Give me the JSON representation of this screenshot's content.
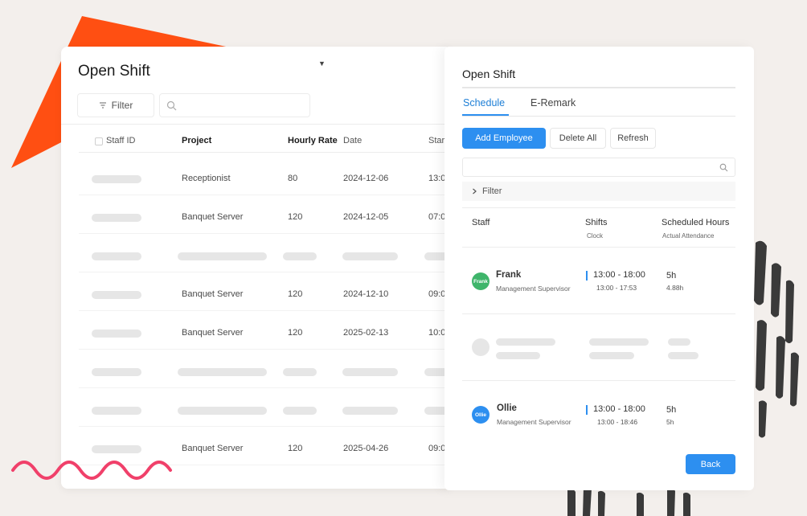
{
  "main": {
    "title": "Open Shift",
    "filter_label": "Filter",
    "search_value": "",
    "columns": {
      "staff_id": "Staff ID",
      "project": "Project",
      "hourly_rate": "Hourly Rate",
      "date": "Date",
      "start": "Start"
    },
    "rows": [
      {
        "project": "Receptionist",
        "rate": "80",
        "date": "2024-12-06",
        "start": "13:0"
      },
      {
        "project": "Banquet Server",
        "rate": "120",
        "date": "2024-12-05",
        "start": "07:0"
      },
      {
        "project": "Banquet Server",
        "rate": "120",
        "date": "2024-12-10",
        "start": "09:0"
      },
      {
        "project": "Banquet Server",
        "rate": "120",
        "date": "2025-02-13",
        "start": "10:0"
      },
      {
        "project": "Banquet Server",
        "rate": "120",
        "date": "2025-04-26",
        "start": "09:0"
      }
    ]
  },
  "panel": {
    "title": "Open Shift",
    "tabs": [
      "Schedule",
      "E-Remark"
    ],
    "buttons": {
      "add_employee": "Add Employee",
      "delete_all": "Delete All",
      "refresh": "Refresh",
      "back": "Back"
    },
    "search_value": "",
    "filter_label": "Filter",
    "headers": {
      "staff": "Staff",
      "shifts": "Shifts",
      "clock": "Clock",
      "scheduled_hours": "Scheduled Hours",
      "actual_attendance": "Actual Attendance"
    },
    "employees": [
      {
        "name": "Frank",
        "avatar_text": "Frank",
        "avatar_color": "#3fb56b",
        "role": "Management Supervisor",
        "shift": "13:00 - 18:00",
        "clock": "13:00  - 17:53",
        "scheduled": "5h",
        "actual": "4.88h"
      },
      {
        "name": "Ollie",
        "avatar_text": "Ollie",
        "avatar_color": "#2d8ff0",
        "role": "Management Supervisor",
        "shift": "13:00 - 18:00",
        "clock": "13:00  - 18:46",
        "scheduled": "5h",
        "actual": "5h"
      }
    ]
  },
  "colors": {
    "accent": "#2d8ff0",
    "decor_orange": "#ff4f12",
    "decor_pink": "#f0406a",
    "decor_dark": "#3a3a3a",
    "background": "#f3efec"
  },
  "icons": {
    "filter": "filter-lines-icon",
    "search": "search-icon",
    "expand": "chevron-right-icon",
    "dropdown": "caret-down-icon"
  }
}
